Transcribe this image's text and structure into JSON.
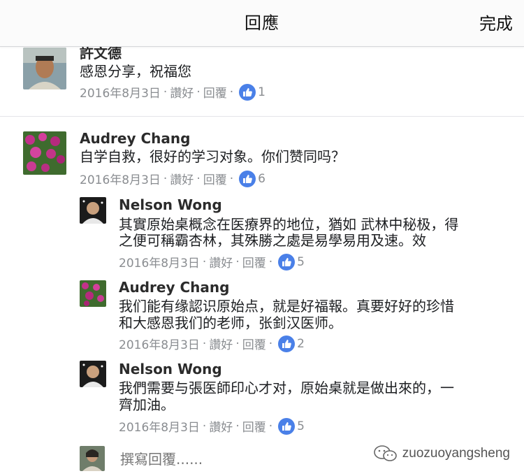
{
  "header": {
    "title": "回應",
    "done_label": "完成"
  },
  "comments": [
    {
      "name": "許文德",
      "lines": [
        "感恩分享，祝福您"
      ],
      "date": "2016年8月3日",
      "like_label": "讚好",
      "reply_label": "回覆",
      "likes": "1"
    },
    {
      "name": "Audrey Chang",
      "lines": [
        "自学自救，很好的学习对象。你们赞同吗？"
      ],
      "date": "2016年8月3日",
      "like_label": "讚好",
      "reply_label": "回覆",
      "likes": "6"
    }
  ],
  "replies": [
    {
      "name": "Nelson Wong",
      "lines": [
        "其實原始桌概念在医療界的地位，猶如 武林中秘极，得",
        "之便可稱霸杏林，其殊勝之處是易學易用及速。效"
      ],
      "date": "2016年8月3日",
      "like_label": "讚好",
      "reply_label": "回覆",
      "likes": "5"
    },
    {
      "name": "Audrey Chang",
      "lines": [
        "我们能有缘認识原始点，就是好福報。真要好好的珍惜",
        "和大感恩我们的老师，张釗汉医师。"
      ],
      "date": "2016年8月3日",
      "like_label": "讚好",
      "reply_label": "回覆",
      "likes": "2"
    },
    {
      "name": "Nelson Wong",
      "lines": [
        "我們需要与張医師印心才对，原始桌就是做出來的，一",
        "齊加油。"
      ],
      "date": "2016年8月3日",
      "like_label": "讚好",
      "reply_label": "回覆",
      "likes": "5"
    }
  ],
  "composer": {
    "placeholder": "撰寫回覆......"
  },
  "watermark": {
    "text": "zuozuoyangsheng"
  },
  "colors": {
    "like_blue": "#4a80e8",
    "meta_gray": "#8a8d91"
  }
}
